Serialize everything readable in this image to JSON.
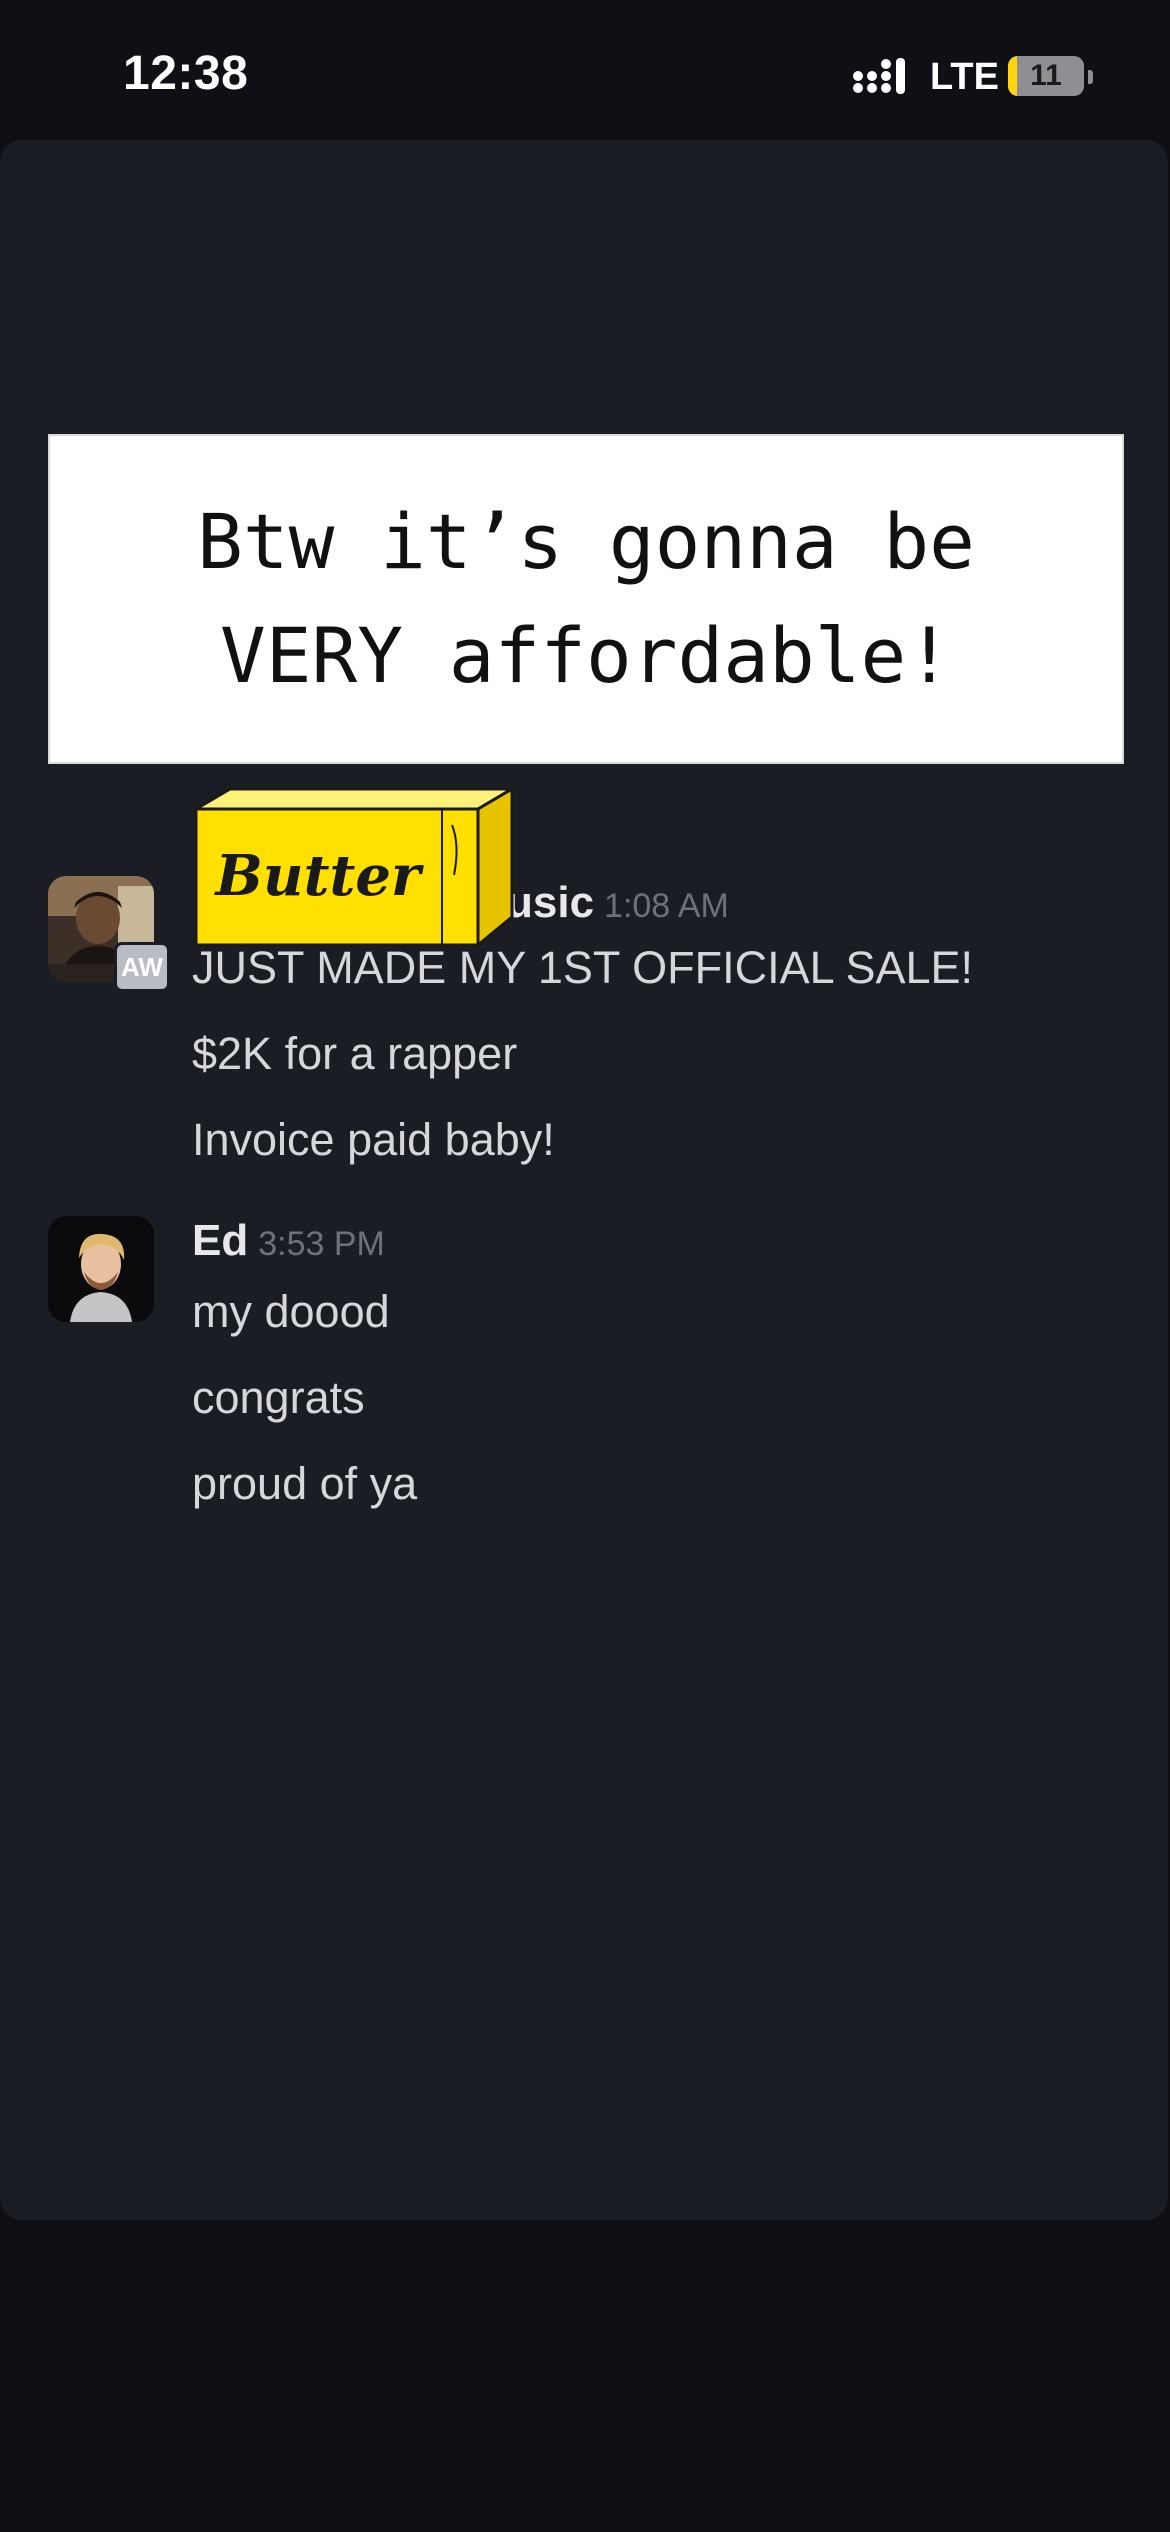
{
  "status_bar": {
    "time": "12:38",
    "network": "LTE",
    "battery_level": "11",
    "icons": [
      "signal-icon",
      "battery-icon"
    ]
  },
  "overlay": {
    "line1": "Btw it’s gonna be",
    "line2": "VERY affordable!"
  },
  "sticker": {
    "text": "Butter",
    "icon": "butter-stick-icon",
    "color": "#ffe000"
  },
  "messages": [
    {
      "sender_partial": "usic",
      "time": "1:08 AM",
      "avatar_badge": "AW",
      "lines": [
        "JUST MADE MY 1ST OFFICIAL SALE!",
        "$2K  for a rapper",
        "Invoice paid baby!"
      ]
    },
    {
      "sender": "Ed",
      "time": "3:53 PM",
      "lines": [
        "my doood",
        "congrats",
        "proud of ya"
      ]
    }
  ],
  "colors": {
    "background": "#0e1015",
    "card": "#1a1d23",
    "text": "#d6d7da",
    "timestamp": "#6e7179"
  }
}
